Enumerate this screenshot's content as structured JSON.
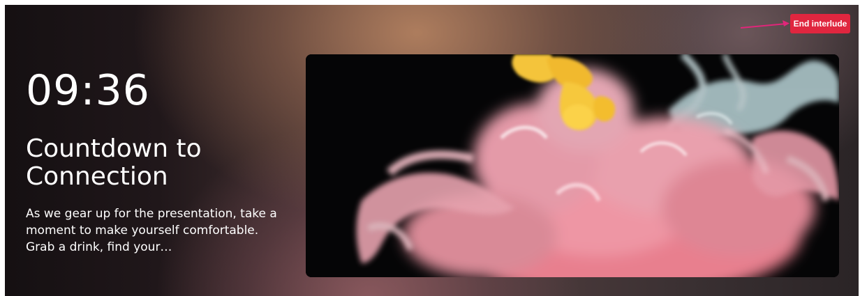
{
  "interlude": {
    "end_button_label": "End interlude",
    "timer": "09:36",
    "title": "Countdown to Connection",
    "description": "As we gear up for the presentation, take a moment to make yourself comfortable. Grab a drink, find your…"
  },
  "media": {
    "icon": "ink-smoke-image"
  },
  "colors": {
    "accent": "#e0263f",
    "arrow": "#e0267a",
    "text": "#ffffff",
    "media_background": "#050506"
  }
}
